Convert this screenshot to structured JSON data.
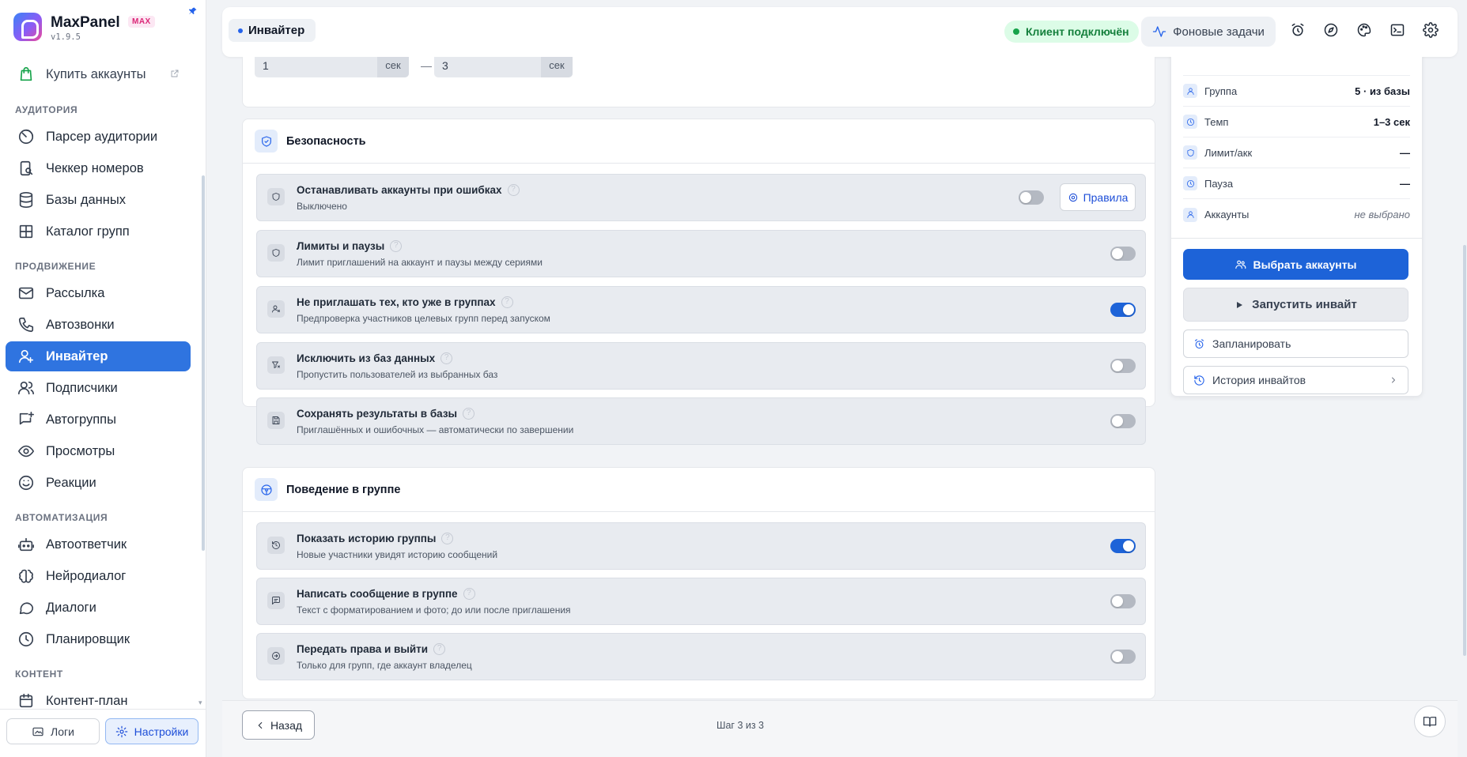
{
  "app": {
    "name": "MaxPanel",
    "badge": "MAX",
    "version": "v1.9.5"
  },
  "sidebar": {
    "buy": "Купить аккаунты",
    "sections": {
      "audience": "АУДИТОРИЯ",
      "promotion": "ПРОДВИЖЕНИЕ",
      "automation": "АВТОМАТИЗАЦИЯ",
      "content": "КОНТЕНТ"
    },
    "items": {
      "parser": "Парсер аудитории",
      "checker": "Чеккер номеров",
      "databases": "Базы данных",
      "catalog": "Каталог групп",
      "mailing": "Рассылка",
      "autocalls": "Автозвонки",
      "inviter": "Инвайтер",
      "subscribers": "Подписчики",
      "autogroups": "Автогруппы",
      "views": "Просмотры",
      "reactions": "Реакции",
      "autoresponder": "Автоответчик",
      "neurodialog": "Нейродиалог",
      "dialogs": "Диалоги",
      "scheduler": "Планировщик",
      "contentplan": "Контент-план"
    },
    "footer": {
      "logs": "Логи",
      "settings": "Настройки"
    }
  },
  "header": {
    "crumb": "Инвайтер",
    "status": "Клиент подключён",
    "bgtasks": "Фоновые задачи"
  },
  "delay": {
    "from": "1",
    "to": "3",
    "unit": "сек",
    "separator": "—"
  },
  "security": {
    "title": "Безопасность",
    "rows": [
      {
        "title": "Останавливать аккаунты при ошибках",
        "sub": "Выключено",
        "on": false,
        "button": "Правила"
      },
      {
        "title": "Лимиты и паузы",
        "sub": "Лимит приглашений на аккаунт и паузы между сериями",
        "on": false
      },
      {
        "title": "Не приглашать тех, кто уже в группах",
        "sub": "Предпроверка участников целевых групп перед запуском",
        "on": true
      },
      {
        "title": "Исключить из баз данных",
        "sub": "Пропустить пользователей из выбранных баз",
        "on": false
      },
      {
        "title": "Сохранять результаты в базы",
        "sub": "Приглашённых и ошибочных — автоматически по завершении",
        "on": false
      }
    ]
  },
  "behavior": {
    "title": "Поведение в группе",
    "rows": [
      {
        "title": "Показать историю группы",
        "sub": "Новые участники увидят историю сообщений",
        "on": true
      },
      {
        "title": "Написать сообщение в группе",
        "sub": "Текст с форматированием и фото; до или после приглашения",
        "on": false
      },
      {
        "title": "Передать права и выйти",
        "sub": "Только для групп, где аккаунт владелец",
        "on": false
      }
    ]
  },
  "help_glyph": "?",
  "summary": {
    "rows": [
      {
        "label": "Группа",
        "value": "5 · из базы"
      },
      {
        "label": "Темп",
        "value": "1–3 сек"
      },
      {
        "label": "Лимит/акк",
        "value": "—"
      },
      {
        "label": "Пауза",
        "value": "—"
      },
      {
        "label": "Аккаунты",
        "value": "не выбрано"
      }
    ],
    "select_accounts": "Выбрать аккаунты",
    "start": "Запустить инвайт",
    "schedule": "Запланировать",
    "history": "История инвайтов"
  },
  "footer": {
    "back": "Назад",
    "step": "Шаг 3 из 3"
  }
}
